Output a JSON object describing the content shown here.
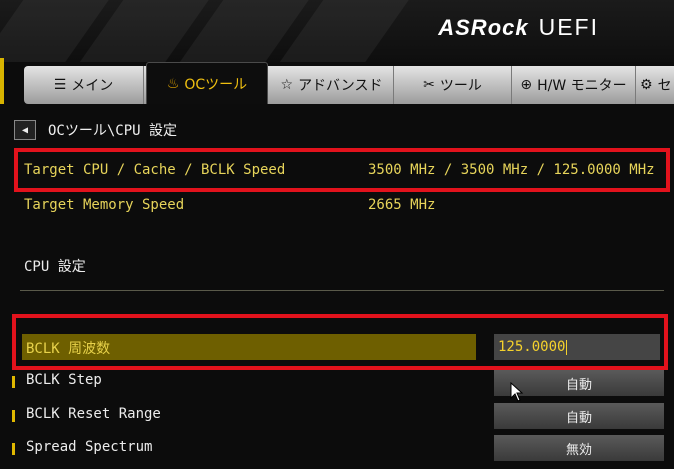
{
  "header": {
    "brand": "ASRock",
    "product": "UEFI"
  },
  "tabs": [
    {
      "icon": "☰",
      "label": "メイン"
    },
    {
      "icon": "♨",
      "label": "OCツール"
    },
    {
      "icon": "☆",
      "label": "アドバンスド"
    },
    {
      "icon": "✂",
      "label": "ツール"
    },
    {
      "icon": "⊕",
      "label": "H/W モニター"
    },
    {
      "icon": "⚙",
      "label": "セ"
    }
  ],
  "breadcrumb": {
    "back_icon": "◀",
    "text": "OCツール\\CPU 設定"
  },
  "info_rows": [
    {
      "label": "Target CPU / Cache / BCLK Speed",
      "value": "3500 MHz / 3500 MHz / 125.0000 MHz"
    },
    {
      "label": "Target Memory Speed",
      "value": "2665 MHz"
    }
  ],
  "section_title": "CPU 設定",
  "bclk": {
    "label": "BCLK 周波数",
    "value": "125.0000"
  },
  "options": [
    {
      "label": "BCLK Step",
      "value": "自動"
    },
    {
      "label": "BCLK Reset Range",
      "value": "自動"
    },
    {
      "label": "Spread Spectrum",
      "value": "無効"
    }
  ],
  "colors": {
    "accent": "#f0c010",
    "highlight_box": "#e2121c",
    "selected_row": "#6e5f00"
  }
}
